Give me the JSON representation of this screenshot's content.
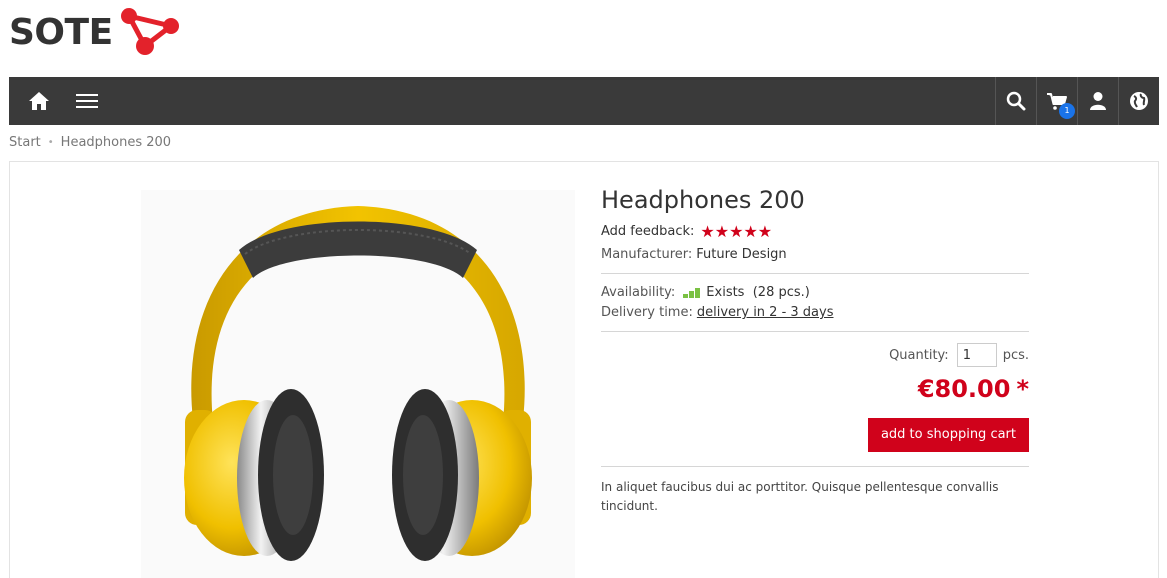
{
  "brand": {
    "name": "SOTE",
    "icon": "sote-molecule-logo",
    "accent": "#e3222b"
  },
  "nav": {
    "left_icons": [
      "home-icon",
      "menu-icon"
    ],
    "right_icons": [
      "search-icon",
      "cart-icon",
      "user-icon",
      "globe-icon"
    ],
    "cart_count": "1",
    "bg_color": "#3a3a3a"
  },
  "breadcrumb": {
    "items": [
      "Start",
      "Headphones 200"
    ]
  },
  "product": {
    "title": "Headphones 200",
    "feedback_label": "Add feedback:",
    "stars": "★★★★★",
    "manufacturer_label": "Manufacturer:",
    "manufacturer": "Future Design",
    "availability_label": "Availability:",
    "availability": "Exists  (28 pcs.)",
    "delivery_label": "Delivery time:",
    "delivery": "delivery in 2 - 3 days",
    "quantity_label": "Quantity:",
    "quantity": "1",
    "quantity_unit": "pcs.",
    "price": "€80.00",
    "price_mark": "*",
    "add_to_cart": "add to shopping cart",
    "description": "In aliquet faucibus dui ac porttitor. Quisque pellentesque convallis tincidunt.",
    "price_color": "#d0021b",
    "availability_color": "#7ac143"
  }
}
